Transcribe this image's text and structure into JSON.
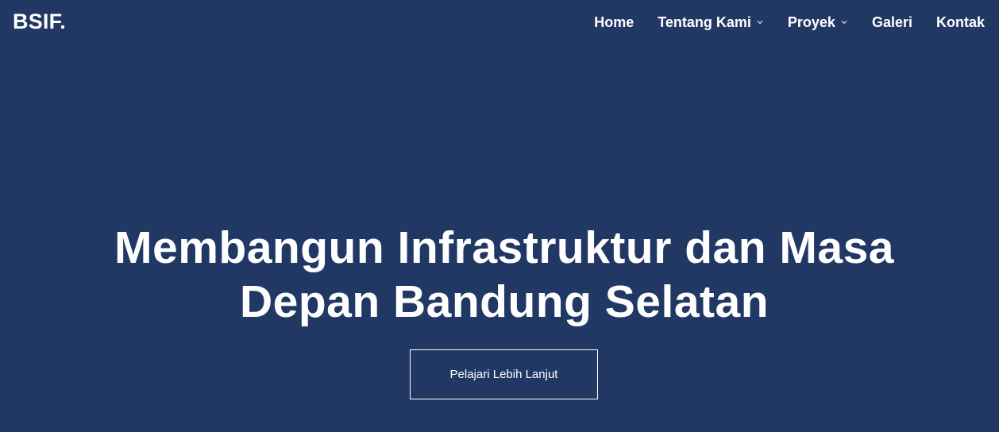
{
  "brand": {
    "name": "BSIF."
  },
  "nav": {
    "items": [
      {
        "label": "Home",
        "has_dropdown": false
      },
      {
        "label": "Tentang Kami",
        "has_dropdown": true,
        "icon": "chevron-down-icon"
      },
      {
        "label": "Proyek",
        "has_dropdown": true,
        "icon": "chevron-down-icon"
      },
      {
        "label": "Galeri",
        "has_dropdown": false
      },
      {
        "label": "Kontak",
        "has_dropdown": false
      }
    ]
  },
  "hero": {
    "title_line1": "Membangun Infrastruktur dan Masa",
    "title_line2": "Depan Bandung Selatan",
    "cta_label": "Pelajari Lebih Lanjut"
  },
  "colors": {
    "background": "#213865",
    "text": "#ffffff",
    "button_border": "#ffffff"
  }
}
